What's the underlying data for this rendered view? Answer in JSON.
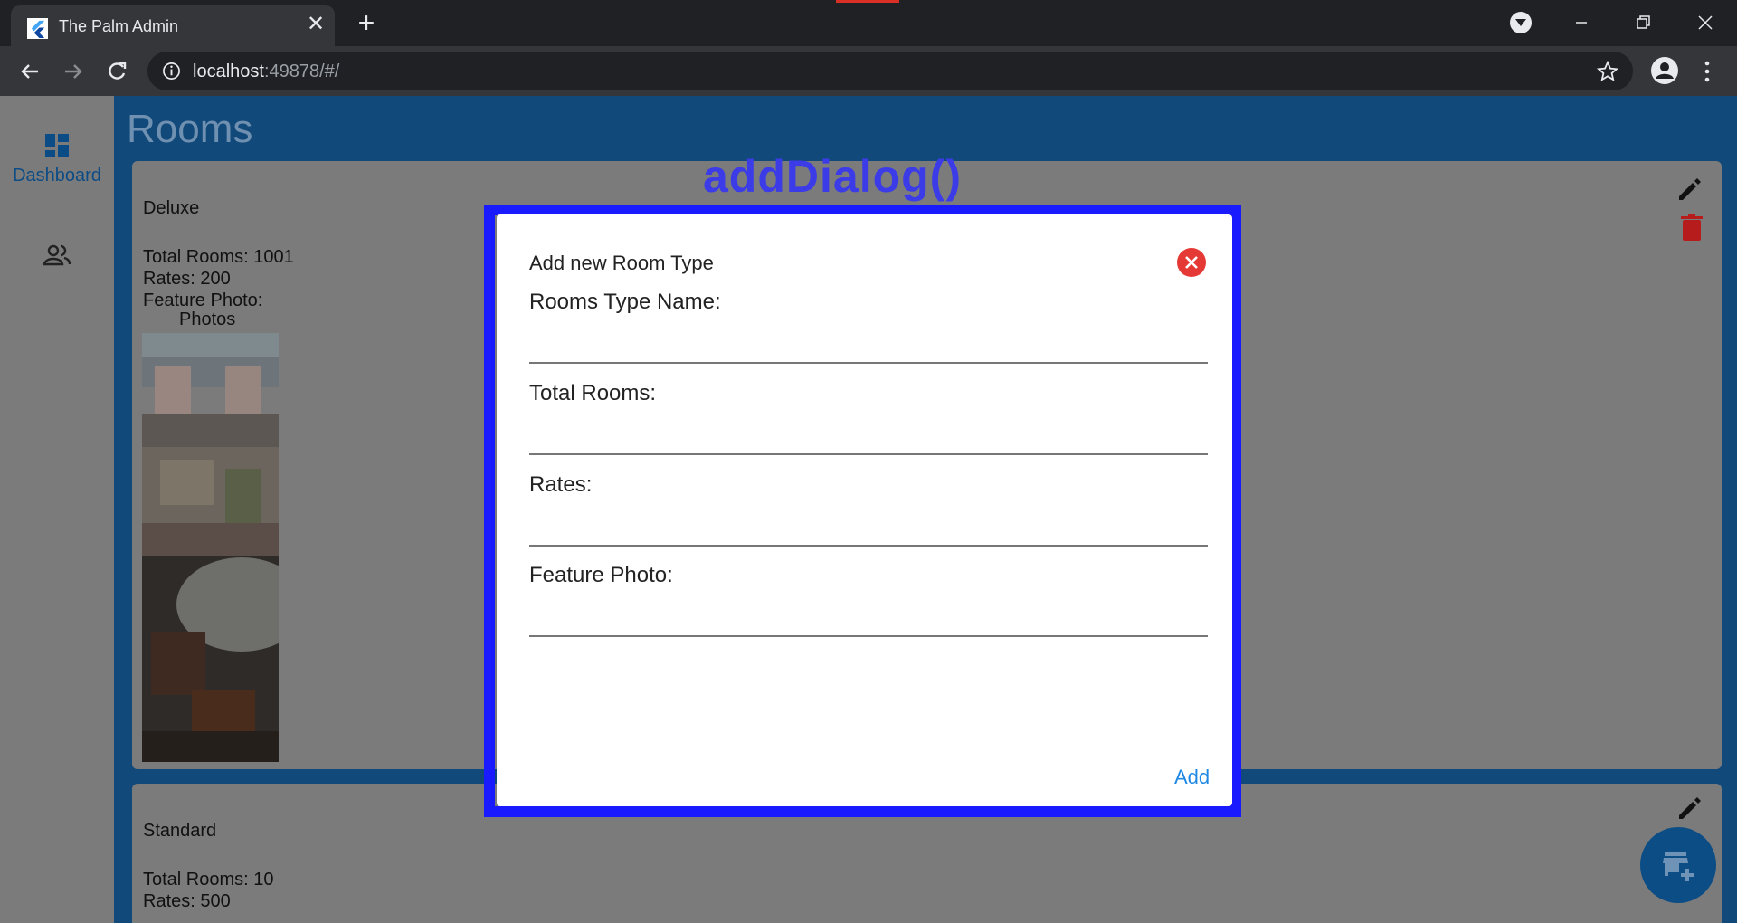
{
  "browser": {
    "tab_title": "The Palm Admin",
    "tab_close": "✕",
    "new_tab": "+",
    "url_host": "localhost",
    "url_rest": ":49878/#/"
  },
  "sidebar": {
    "items": [
      {
        "label": "Dashboard",
        "icon": "dashboard-icon"
      },
      {
        "label": "",
        "icon": "people-icon"
      }
    ]
  },
  "page": {
    "title": "Rooms"
  },
  "rooms": [
    {
      "name": "Deluxe",
      "total_rooms": "Total Rooms: 1001",
      "rates": "Rates: 200",
      "feature_photo": "Feature Photo:",
      "photos_label": "Photos"
    },
    {
      "name": "Standard",
      "total_rooms": "Total Rooms: 10",
      "rates": "Rates: 500"
    }
  ],
  "annotation": {
    "label": "addDialog()"
  },
  "dialog": {
    "title": "Add new Room Type",
    "fields": [
      {
        "label": "Rooms Type Name:",
        "value": ""
      },
      {
        "label": "Total Rooms:",
        "value": ""
      },
      {
        "label": "Rates:",
        "value": ""
      },
      {
        "label": "Feature Photo:",
        "value": ""
      }
    ],
    "add_label": "Add"
  },
  "colors": {
    "accent": "#1e88e5",
    "app_bar": "#11497a",
    "highlight": "#1a1aff",
    "close": "#e53935"
  }
}
